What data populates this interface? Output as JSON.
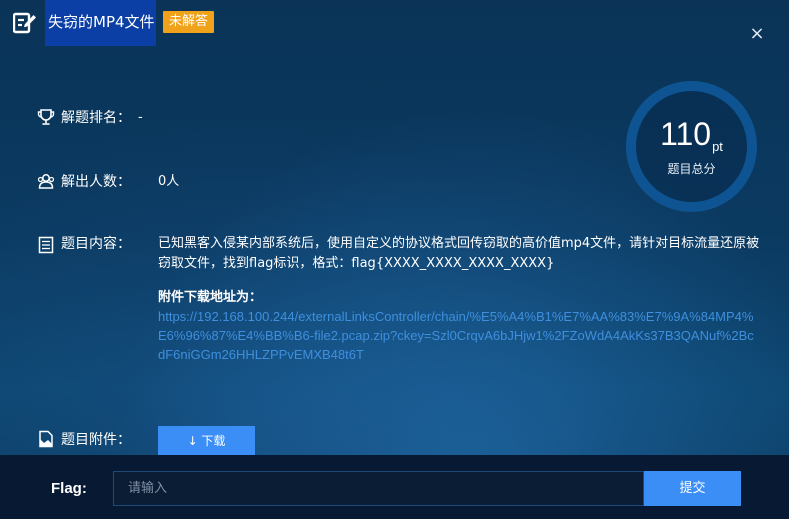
{
  "header": {
    "title": "失窃的MP4文件",
    "status": "未解答",
    "close_label": "×"
  },
  "score": {
    "value": "110",
    "unit": "pt",
    "label": "题目总分"
  },
  "rank": {
    "label": "解题排名：",
    "value": "-"
  },
  "solvers": {
    "label": "解出人数：",
    "value": "0人"
  },
  "content": {
    "label": "题目内容：",
    "description": "已知黑客入侵某内部系统后，使用自定义的协议格式回传窃取的高价值mp4文件，请针对目标流量还原被窃取文件，找到flag标识，格式：flag{XXXX_XXXX_XXXX_XXXX}",
    "attachment_title": "附件下载地址为：",
    "attachment_url": "https://192.168.100.244/externalLinksController/chain/%E5%A4%B1%E7%AA%83%E7%9A%84MP4%E6%96%87%E4%BB%B6-file2.pcap.zip?ckey=Szl0CrqvA6bJHjw1%2FZoWdA4AkKs37B3QANuf%2BcdF6niGGm26HHLZPPvEMXB48t6T"
  },
  "attachment": {
    "label": "题目附件：",
    "download_label": "↓ 下载"
  },
  "footer": {
    "flag_label": "Flag:",
    "input_placeholder": "请输入",
    "submit_label": "提交"
  },
  "colors": {
    "accent": "#3b8ef5",
    "badge": "#f0a21a",
    "link": "#3f8fde",
    "title_bg": "#0b3fa5"
  }
}
